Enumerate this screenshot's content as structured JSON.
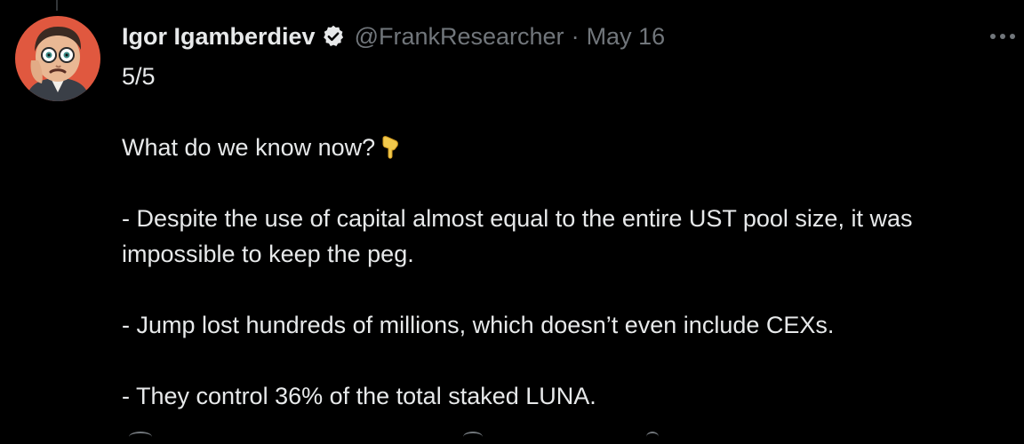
{
  "tweet": {
    "author": {
      "display_name": "Igor Igamberdiev",
      "handle": "@FrankResearcher",
      "verified": true
    },
    "separator": "·",
    "date": "May 16",
    "more_label": "···",
    "text": {
      "counter": "5/5",
      "intro": "What do we know now?",
      "intro_emoji": "pointing-down-emoji",
      "point_1": "- Despite the use of capital almost equal to the entire UST pool size, it was impossible to keep the peg.",
      "point_2": "- Jump lost hundreds of millions, which doesn’t even include CEXs.",
      "point_3": "- They control 36% of the total staked LUNA."
    }
  },
  "colors": {
    "background": "#000000",
    "primary_text": "#e7e9ea",
    "secondary_text": "#71767b",
    "verified_badge": "#e7e9ea"
  }
}
